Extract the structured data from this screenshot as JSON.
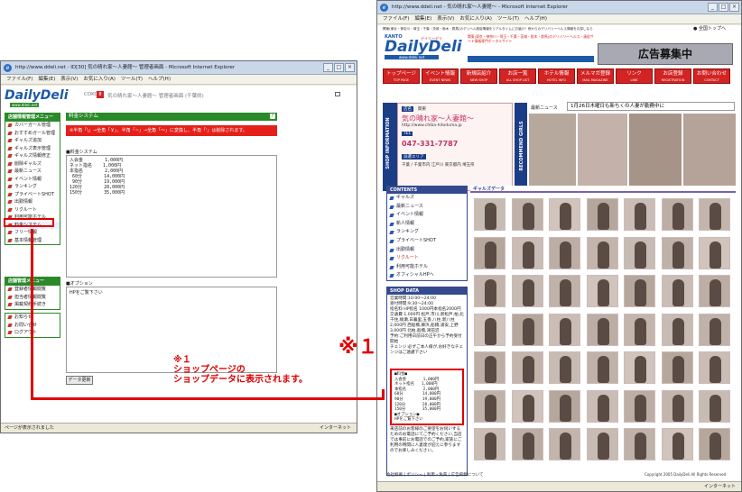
{
  "left_window": {
    "title": "http://www.ddeli.net - ID[30] 気の晴れ家〜人妻館〜 管理者画面 - Microsoft Internet Explorer",
    "menu": [
      "ファイル(F)",
      "編集(E)",
      "表示(V)",
      "お気に入り(A)",
      "ツール(T)",
      "ヘルプ(H)"
    ],
    "logo_text": "DailyDeli",
    "logo_sub": "www.ddeli.net",
    "header_id": "COKC",
    "header_title": "気の晴れ家〜人妻館〜 管理者画面 (千葉県)",
    "nav_group1_title": "店舗情報管理メニュー",
    "nav_items": [
      "カバーガール管理",
      "おすすめガール管理",
      "ギャルズ追加",
      "ギャルズ表示管理",
      "ギャルズ情報修正",
      "削除ギャルズ",
      "最新ニュース",
      "イベント情報",
      "ランキング",
      "プライベートSHOT",
      "出勤情報",
      "リクルート",
      "利用可能ホテル",
      "料金システム",
      "フリー情報",
      "基本情報管理"
    ],
    "nav_group2_title": "店舗管理メニュー",
    "nav_items2": [
      "登録者情報閲覧",
      "担当者情報閲覧",
      "掲載契約手続き"
    ],
    "nav_items3": [
      "お知らせ",
      "お問い合せ",
      "ログアウト"
    ],
    "section_title": "料金システム",
    "alert_text": "※半角「\\」→全角「￥」、半角「~」→全角「～」に変換し、半角「'」は削除されます。",
    "price_label": "■料金システム",
    "price_text": "入会金        1,000円\nネット指名    1,000円\n本指名        2,000円\n 60分        14,000円\n 90分        19,000円\n120分        28,000円\n150分        35,000円",
    "option_label": "■オプション",
    "option_text": "HPをご覧下さい",
    "update_button": "データ更新",
    "status_text": "ページが表示されました",
    "status_zone": "インターネット"
  },
  "right_window": {
    "title": "http://www.ddeli.net - 気の晴れ家〜人妻館〜 - Microsoft Internet Explorer",
    "menu": [
      "ファイル(F)",
      "編集(E)",
      "表示(V)",
      "お気に入り(A)",
      "ツール(T)",
      "ヘルプ(H)"
    ],
    "top_text": "関東(東京・神奈川・埼玉・千葉・茨城・栃木・群馬)のデリヘル風俗情報をリアルタイムにお届け！夜からのデリバリーヘルス情報をお探しなら",
    "home_link": "全国トップへ",
    "logo_region": "KANTO",
    "logo_text": "DailyDeli",
    "logo_ruby": "デイリーデリ",
    "logo_url": "www.ddeli.net",
    "banner_blurb": "関東(東京・神奈川・埼玉・千葉・茨城・栃木・群馬)のデリバリーヘルス・風俗サイト情報専門ポータルサイト",
    "ad_banner": "広告募集中",
    "tabs": [
      {
        "label": "トップページ",
        "sub": "TOP PAGE"
      },
      {
        "label": "イベント情報",
        "sub": "EVENT NEWS"
      },
      {
        "label": "新規店紹介",
        "sub": "NEW SHOP"
      },
      {
        "label": "お店一覧",
        "sub": "ALL SHOP LIST"
      },
      {
        "label": "ホテル情報",
        "sub": "HOTEL INFO"
      },
      {
        "label": "メルマガ登録",
        "sub": "MAIL MAGAZINE"
      },
      {
        "label": "リンク",
        "sub": "LINK"
      },
      {
        "label": "お店登録",
        "sub": "REGISTRATION"
      },
      {
        "label": "お問い合わせ",
        "sub": "CONTACT"
      }
    ],
    "shop_info_side": "SHOP INFORMATION",
    "shop_badge": "店名",
    "shop_region": "関東",
    "shop_name": "気の晴れ家〜人妻館〜",
    "shop_url": "http://www.chiba-hitoduma.jp",
    "tel_label": "TEL",
    "tel": "047-331-7787",
    "area_label": "派遣エリア",
    "area": "千葉 / 千葉市内 江戸川 東京都内 埼玉県",
    "recommend_side": "RECOMMEND GIRLS",
    "news_label": "最新ニュース",
    "news_text": "1月26日木曜日も新ちくの人妻が勤務中に",
    "contents_title": "CONTENTS",
    "contents": [
      "ギャルズ",
      "最新ニュース",
      "イベント情報",
      "新人情報",
      "ランキング",
      "プライベートSHOT",
      "出勤情報",
      "リクルート",
      "利用可能ホテル",
      "オフィシャルHPへ"
    ],
    "shop_data_title": "SHOP DATA",
    "shop_data_text": "営業時間:10:00〜24:00\n受付時間:9:30〜24:00\n指名料:HP指名 1000円本指名2000円\n交通費:1,000円 松戸,市川,新松戸,柏,北千住,綾瀬,日暮里,五香,八柱,新八柱 2,000円 西船橋,舞浜,船橋,浦安,上野 3,000円 北柏,船橋,津田沼\n予約:ご利用日前日の正午から予約受付開始\nチェンジ:必ずご本人様が,お好きなチェンジはご遠慮下さい",
    "price_box_text": "■料金■\n入会金       1,000円\nネット指名   1,000円\n本指名       2,000円\n60分        14,000円\n90分        19,000円\n120分       28,000円\n150分       35,000円\n■オプション■\nHPをご覧下さい",
    "extra_text": "来店前のお客様のご要望をお伺いするためのお電話にてご予約ください,当店では事前にお電話でのご予約,家族にご利用の時間に人妻達が迎えに参りますのでお楽しみください。",
    "gallery_title": "ギャルズデータ",
    "footer_links": "会社概要 | ポリシー | 利用・免責 | 広告掲載について",
    "copyright": "Copyright 2005 DailyDeli All Rights Reserved",
    "status_zone": "インターネット"
  },
  "annotation": {
    "mark": "※１",
    "note_mark": "※１",
    "note_line1": "ショップページの",
    "note_line2": "ショップデータに表示されます。",
    "color": "#e00000"
  }
}
